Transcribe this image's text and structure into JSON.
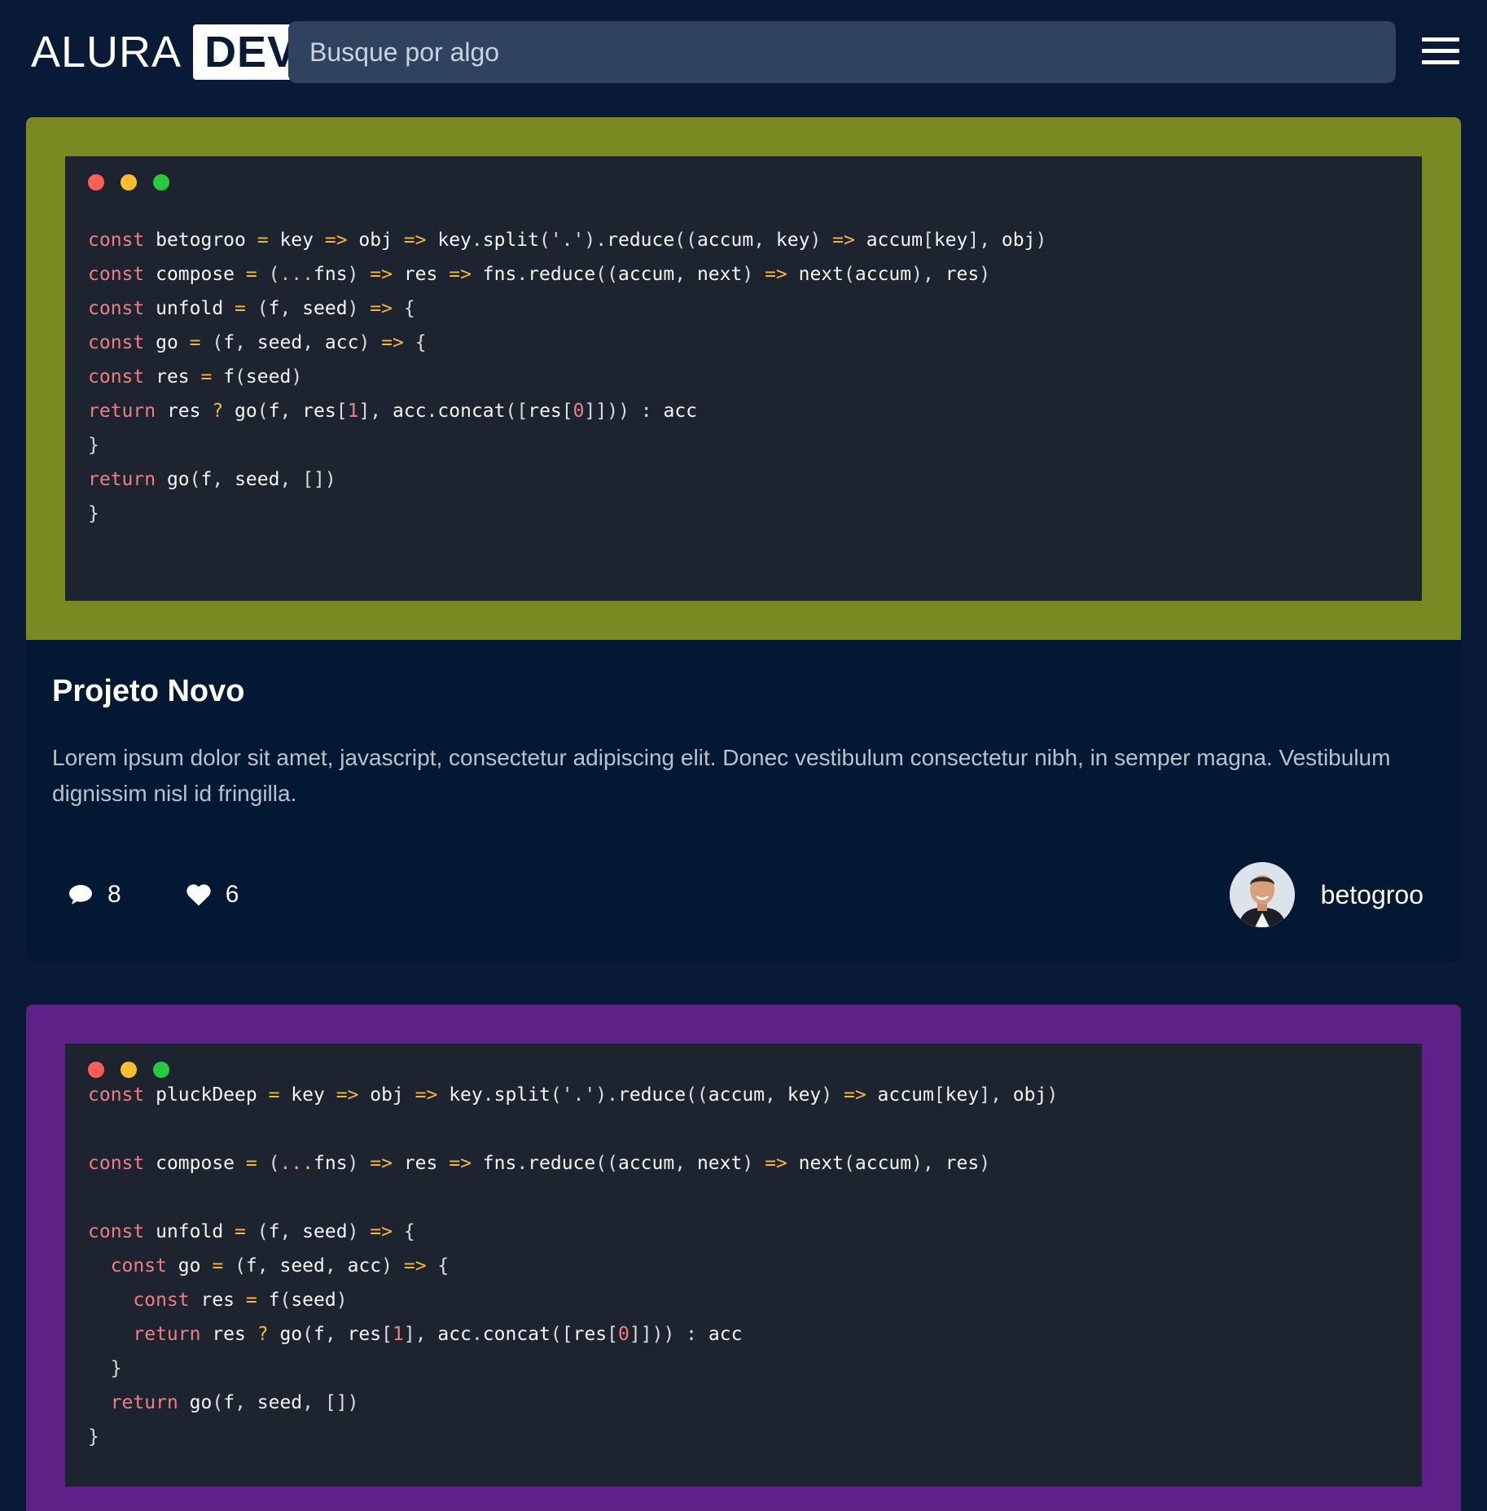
{
  "header": {
    "logo_left": "ALURA",
    "logo_right": "DEV",
    "search_placeholder": "Busque por algo"
  },
  "icons": {
    "menu": "hamburger-menu-icon",
    "comments": "comment-bubble-icon",
    "likes": "heart-icon"
  },
  "colors": {
    "background": "#081a36",
    "card1_frame": "#7a8a22",
    "card2_frame": "#5e2187",
    "editor": "#1e2330",
    "dot_red": "#ff5f56",
    "dot_yellow": "#ffbd2e",
    "dot_green": "#27c93f"
  },
  "posts": [
    {
      "code_lines": [
        "const betogroo = key => obj => key.split('.').reduce((accum, key) => accum[key], obj)",
        "const compose = (...fns) => res => fns.reduce((accum, next) => next(accum), res)",
        "const unfold = (f, seed) => {",
        "const go = (f, seed, acc) => {",
        "const res = f(seed)",
        "return res ? go(f, res[1], acc.concat([res[0]])) : acc",
        "}",
        "return go(f, seed, [])",
        "}"
      ],
      "title": "Projeto Novo",
      "description": "Lorem ipsum dolor sit amet, javascript, consectetur adipiscing elit. Donec vestibulum consectetur nibh, in semper magna. Vestibulum dignissim nisl id fringilla.",
      "comments": "8",
      "likes": "6",
      "author": "betogroo"
    },
    {
      "code_lines": [
        "const pluckDeep = key => obj => key.split('.').reduce((accum, key) => accum[key], obj)",
        "",
        "const compose = (...fns) => res => fns.reduce((accum, next) => next(accum), res)",
        "",
        "const unfold = (f, seed) => {",
        "  const go = (f, seed, acc) => {",
        "    const res = f(seed)",
        "    return res ? go(f, res[1], acc.concat([res[0]])) : acc",
        "  }",
        "  return go(f, seed, [])",
        "}"
      ]
    }
  ]
}
